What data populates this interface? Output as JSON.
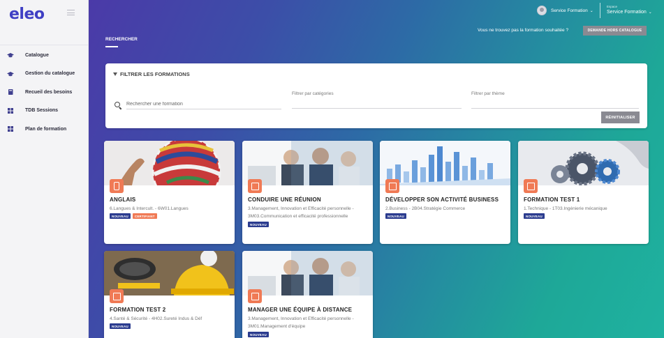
{
  "sidebar": {
    "logo": "eleo",
    "items": [
      {
        "label": "Catalogue",
        "icon": "graduation-cap-icon"
      },
      {
        "label": "Gestion du catalogue",
        "icon": "graduation-cap-icon"
      },
      {
        "label": "Recueil des besoins",
        "icon": "book-icon"
      },
      {
        "label": "TDB Sessions",
        "icon": "grid-icon"
      },
      {
        "label": "Plan de formation",
        "icon": "grid-icon"
      }
    ]
  },
  "topbar": {
    "user_name": "Service Formation",
    "espace_label": "Espace",
    "espace_value": "Service Formation"
  },
  "header": {
    "not_found_text": "Vous ne trouvez pas la formation souhaitée ?",
    "request_button": "DEMANDE HORS CATALOGUE",
    "tab_label": "RECHERCHER"
  },
  "filter": {
    "title": "FILTRER LES FORMATIONS",
    "search_placeholder": "Rechercher une formation",
    "category_label": "Filtrer par catégories",
    "theme_label": "Filtrer par thème",
    "reset_button": "RÉINITIALISER"
  },
  "cards": [
    {
      "title": "ANGLAIS",
      "subtitle": "6.Langues & Intercult. - 6W01.Langues",
      "tags": [
        "NOUVEAU",
        "CERTIFIANT"
      ],
      "badge_icon": "mobile-icon"
    },
    {
      "title": "CONDUIRE UNE RÉUNION",
      "subtitle": "3.Management, Innovation et Efficacité personnelle - 3M03.Communication et efficacité professionnelle",
      "tags": [
        "NOUVEAU"
      ],
      "badge_icon": "classroom-icon"
    },
    {
      "title": "DÉVELOPPER SON ACTIVITÉ BUSINESS",
      "subtitle": "2.Business - 2B04.Stratégie Commerce",
      "tags": [
        "NOUVEAU"
      ],
      "badge_icon": "image-icon"
    },
    {
      "title": "FORMATION TEST 1",
      "subtitle": "1.Technique - 1T03.Ingénierie mécanique",
      "tags": [
        "NOUVEAU"
      ],
      "badge_icon": "classroom-icon"
    },
    {
      "title": "FORMATION TEST 2",
      "subtitle": "4.Santé & Sécurité - 4H02.Sureté Indus & Déf",
      "tags": [
        "NOUVEAU"
      ],
      "badge_icon": "image-icon"
    },
    {
      "title": "MANAGER UNE ÉQUIPE À DISTANCE",
      "subtitle": "3.Management, Innovation et Efficacité personnelle - 3M01.Management d'équipe",
      "tags": [
        "NOUVEAU"
      ],
      "badge_icon": "classroom-icon"
    }
  ]
}
